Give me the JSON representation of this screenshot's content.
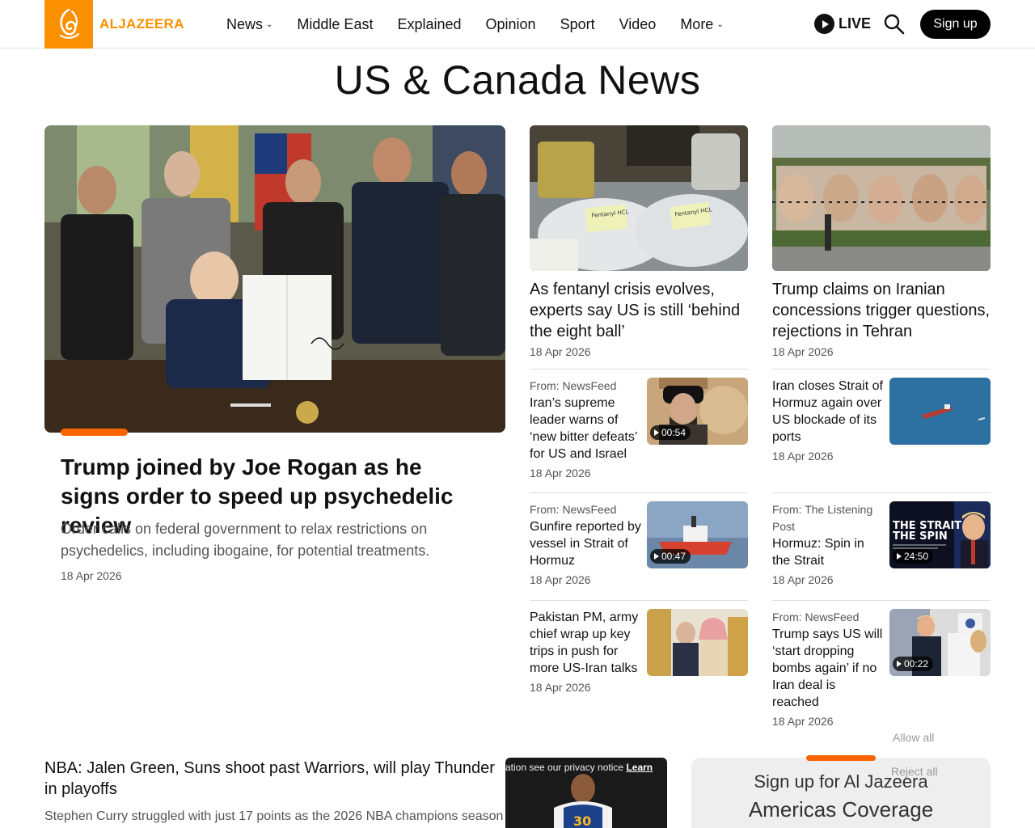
{
  "header": {
    "logo_text": "ALJAZEERA",
    "nav": [
      "News",
      "Middle East",
      "Explained",
      "Opinion",
      "Sport",
      "Video",
      "More"
    ],
    "live_label": "LIVE",
    "signup_label": "Sign up"
  },
  "page_title": "US & Canada News",
  "hero": {
    "title": "Trump joined by Joe Rogan as he signs order to speed up psychedelic review",
    "summary": "Order calls on federal government to relax restrictions on psychedelics, including ibogaine, for potential treatments.",
    "date": "18 Apr 2026"
  },
  "featured": [
    {
      "title": "As fentanyl crisis evolves, experts say US is still ‘behind the eight ball’",
      "date": "18 Apr 2026"
    },
    {
      "title": "Trump claims on Iranian concessions trigger questions, rejections in Tehran",
      "date": "18 Apr 2026"
    }
  ],
  "cards": [
    {
      "from": "From: NewsFeed",
      "title": "Iran’s supreme leader warns of ‘new bitter defeats’ for US and Israel",
      "date": "18 Apr 2026",
      "duration": "00:54"
    },
    {
      "from": "",
      "title": "Iran closes Strait of Hormuz again over US blockade of its ports",
      "date": "18 Apr 2026",
      "duration": ""
    },
    {
      "from": "From: NewsFeed",
      "title": "Gunfire reported by vessel in Strait of Hormuz",
      "date": "18 Apr 2026",
      "duration": "00:47"
    },
    {
      "from": "From: The Listening Post",
      "title": "Hormuz: Spin in the Strait",
      "date": "18 Apr 2026",
      "duration": "24:50"
    },
    {
      "from": "",
      "title": "Pakistan PM, army chief wrap up key trips in push for more US-Iran talks",
      "date": "18 Apr 2026",
      "duration": ""
    },
    {
      "from": "From: NewsFeed",
      "title": "Trump says US will ‘start dropping bombs again’ if no Iran deal is reached",
      "date": "18 Apr 2026",
      "duration": "00:22"
    }
  ],
  "thumb_text": {
    "fentanyl_label_1": "Fentanyl HCL",
    "fentanyl_label_2": "Fentanyl HCL",
    "spin_line_1": "THE STRAIT",
    "spin_line_2": "THE SPIN"
  },
  "bottom": {
    "nba_title": "NBA: Jalen Green, Suns shoot past Warriors, will play Thunder in playoffs",
    "nba_summary": "Stephen Curry struggled with just 17 points as the 2026 NBA champions season",
    "privacy_text": "ation see our privacy notice",
    "privacy_link": "Learn",
    "jersey_number": "30",
    "newsletter_line1": "Sign up for Al Jazeera",
    "newsletter_line2": "Americas Coverage",
    "cookie_allow": "Allow all",
    "cookie_reject": "Reject all"
  },
  "colors": {
    "accent": "#fa9000",
    "accent_bar": "#fa6400"
  }
}
